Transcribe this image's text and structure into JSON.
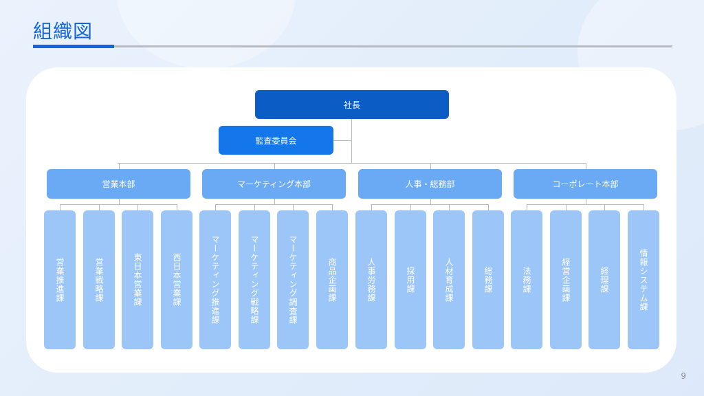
{
  "title": "組織図",
  "page_number": "9",
  "org": {
    "ceo": "社長",
    "audit": "監査委員会",
    "divisions": [
      {
        "name": "営業本部",
        "sections": [
          "営業推進課",
          "営業戦略課",
          "東日本営業課",
          "西日本営業課"
        ]
      },
      {
        "name": "マーケティング本部",
        "sections": [
          "マーケティング推進課",
          "マーケティング戦略課",
          "マーケティング調査課",
          "商品企画課"
        ]
      },
      {
        "name": "人事・総務部",
        "sections": [
          "人事労務課",
          "採用課",
          "人材育成課",
          "総務課"
        ]
      },
      {
        "name": "コーポレート本部",
        "sections": [
          "法務課",
          "経営企画課",
          "経理課",
          "情報システム課"
        ]
      }
    ]
  },
  "colors": {
    "accent": "#1565d8",
    "ceo": "#0b5cc5",
    "audit": "#1476eb",
    "division": "#6aaaf5",
    "section": "#9cc6f7",
    "connector": "#b5b9c0"
  }
}
